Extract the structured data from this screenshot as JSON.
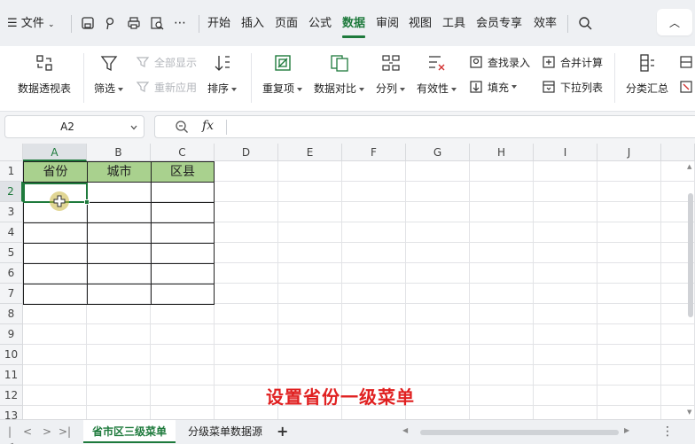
{
  "menubar": {
    "file_label": "文件",
    "tabs": [
      {
        "label": "开始",
        "active": false
      },
      {
        "label": "插入",
        "active": false
      },
      {
        "label": "页面",
        "active": false
      },
      {
        "label": "公式",
        "active": false
      },
      {
        "label": "数据",
        "active": true
      },
      {
        "label": "审阅",
        "active": false
      },
      {
        "label": "视图",
        "active": false
      },
      {
        "label": "工具",
        "active": false
      },
      {
        "label": "会员专享",
        "active": false
      },
      {
        "label": "效率",
        "active": false
      }
    ]
  },
  "ribbon": {
    "pivot": "数据透视表",
    "filter": "筛选",
    "show_all": "全部显示",
    "reapply": "重新应用",
    "sort": "排序",
    "duplicates": "重复项",
    "compare": "数据对比",
    "split": "分列",
    "validity": "有效性",
    "lookup_entry": "查找录入",
    "fill": "填充",
    "consolidate": "合并计算",
    "dropdown_list": "下拉列表",
    "subtotal": "分类汇总"
  },
  "formula_bar": {
    "cell_ref": "A2",
    "fx_label": "fx",
    "value": ""
  },
  "grid": {
    "columns": [
      "A",
      "B",
      "C",
      "D",
      "E",
      "F",
      "G",
      "H",
      "I",
      "J"
    ],
    "rows": [
      "1",
      "2",
      "3",
      "4",
      "5",
      "6",
      "7",
      "8",
      "9",
      "10",
      "11",
      "12",
      "13"
    ],
    "selected_col": "A",
    "selected_row": "2",
    "table_headers": [
      "省份",
      "城市",
      "区县"
    ],
    "header_fill": "#a9d18e"
  },
  "caption": "设置省份一级菜单",
  "sheets": [
    {
      "label": "省市区三级菜单",
      "active": true
    },
    {
      "label": "分级菜单数据源",
      "active": false
    }
  ],
  "accent_color": "#1e7a3c"
}
